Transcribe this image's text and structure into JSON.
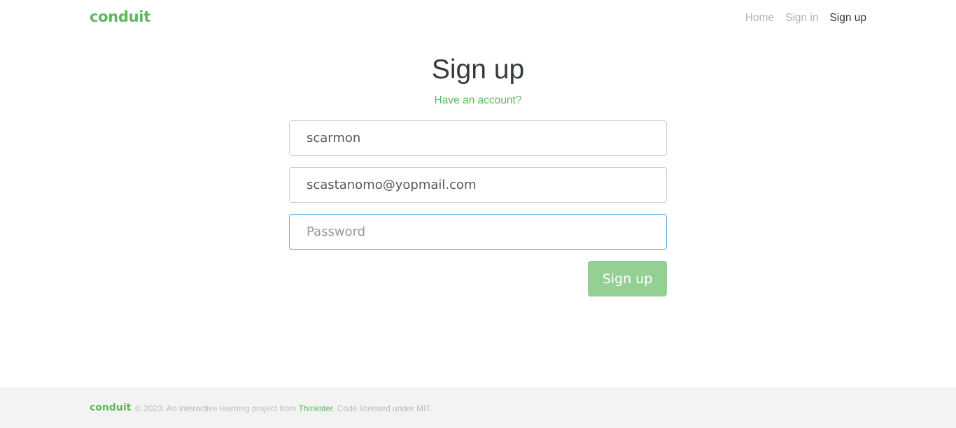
{
  "navbar": {
    "brand": "conduit",
    "links": [
      {
        "label": "Home"
      },
      {
        "label": "Sign in"
      },
      {
        "label": "Sign up",
        "active": true
      }
    ]
  },
  "auth": {
    "title": "Sign up",
    "have_account": "Have an account?",
    "username": {
      "value": "scarmon"
    },
    "email": {
      "value": "scastanomo@yopmail.com"
    },
    "password": {
      "value": "",
      "placeholder": "Password"
    },
    "submit_label": "Sign up"
  },
  "footer": {
    "logo": "conduit",
    "text_before": "© 2023. An interactive learning project from ",
    "link": "Thinkster",
    "text_after": ". Code licensed under MIT."
  },
  "colors": {
    "brand": "#5cb85c",
    "button_disabled": "#94d094",
    "focus_border": "#66afe9",
    "footer_bg": "#f3f3f3"
  }
}
